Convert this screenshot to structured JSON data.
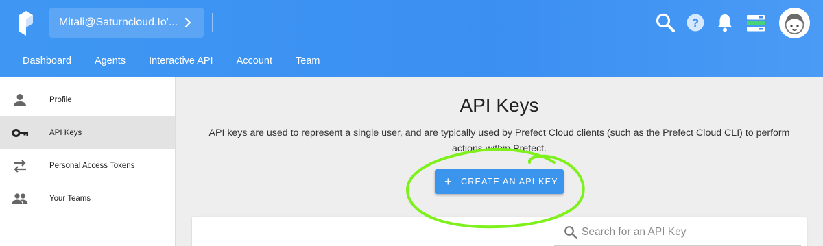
{
  "header": {
    "tenant_label": "Mitali@Saturncloud.Io'...",
    "nav_tabs": [
      "Dashboard",
      "Agents",
      "Interactive API",
      "Account",
      "Team"
    ]
  },
  "sidebar": {
    "items": [
      {
        "label": "Profile",
        "icon": "person-icon"
      },
      {
        "label": "API Keys",
        "icon": "key-icon",
        "active": true
      },
      {
        "label": "Personal Access Tokens",
        "icon": "swap-arrows-icon"
      },
      {
        "label": "Your Teams",
        "icon": "people-icon"
      }
    ]
  },
  "main": {
    "title": "API Keys",
    "description": "API keys are used to represent a single user, and are typically used by Prefect Cloud clients (such as the Prefect Cloud CLI) to perform actions within Prefect.",
    "create_button_label": "CREATE AN API KEY",
    "search_placeholder": "Search for an API Key"
  },
  "colors": {
    "header": "#3f97f3",
    "button": "#3b95ed",
    "annotation": "#7ef01c"
  }
}
